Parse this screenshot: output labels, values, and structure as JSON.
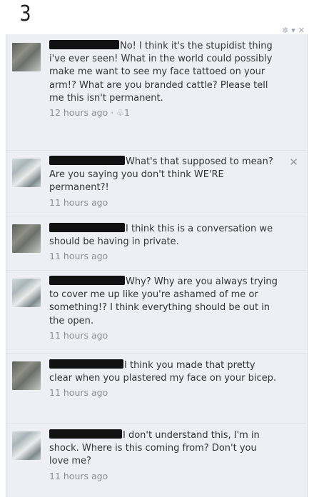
{
  "page_number": "3",
  "top_actions": {
    "gear_icon": "gear-icon",
    "chevron_icon": "chevron-down-icon",
    "close_icon": "close-icon"
  },
  "comments": [
    {
      "author_avatar": "male",
      "text": "No! I think it's the stupidist thing i've ever seen! What in the world could possibly make me want to see my face tattoed on your arm!? What are you branded cattle? Please tell me this isn't permanent.",
      "time": "12 hours ago",
      "separator": " · ",
      "likes": "1"
    },
    {
      "author_avatar": "female",
      "text": "What's that supposed to mean? Are you saying you don't think WE'RE permanent?!",
      "time": "11 hours ago"
    },
    {
      "author_avatar": "male",
      "text": "I think this is a conversation we should be having in private.",
      "time": "11 hours ago"
    },
    {
      "author_avatar": "female",
      "text": "Why? Why are you always trying to cover me up like you're ashamed of me or something!? I think everything should be out in the open.",
      "time": "11 hours ago"
    },
    {
      "author_avatar": "male",
      "text": "I think you made that pretty clear when you plastered my face on your bicep.",
      "time": "11 hours ago"
    },
    {
      "author_avatar": "female",
      "text": "I don't understand this, I'm in shock. Where is this coming from? Don't you love me?",
      "time": "11 hours ago"
    }
  ]
}
